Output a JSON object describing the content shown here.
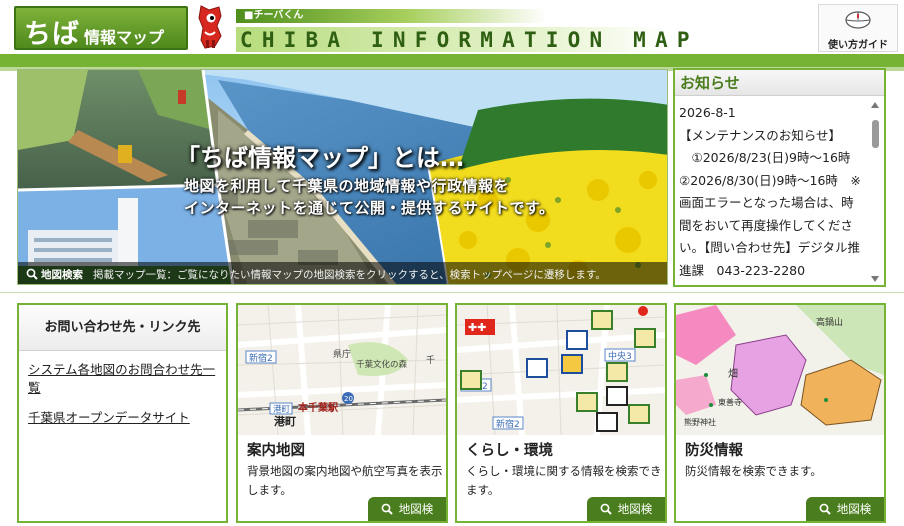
{
  "header": {
    "logo_main": "ちば",
    "logo_sub": "情報マップ",
    "mascot_label": "■チーバくん",
    "title": "CHIBA INFORMATION MAP",
    "guide_label": "使い方ガイド",
    "guide_icon": "mouse-icon"
  },
  "hero": {
    "heading": "「ちば情報マップ」とは…",
    "line1": "地図を利用して千葉県の地域情報や行政情報を",
    "line2": "インターネットを通じて公開・提供するサイトです。",
    "caption_label": "地図検索",
    "caption_text": "掲載マップ一覧：ご覧になりたい情報マップの地図検索をクリックすると、検索トップページに遷移します。"
  },
  "notice": {
    "title": "お知らせ",
    "body": "2026-8-1\n【メンテナンスのお知らせ】\n　①2026/8/23(日)9時〜16時　②2026/8/30(日)9時〜16時　※画面エラーとなった場合は、時間をおいて再度操作してください。【問い合わせ先】デジタル推進課　043-223-2280"
  },
  "contact": {
    "heading": "お問い合わせ先・リンク先",
    "links": [
      "システム各地図のお問合わせ先一覧",
      "千葉県オープンデータサイト"
    ]
  },
  "cards": [
    {
      "title": "案内地図",
      "desc": "背景地図の案内地図や航空写真を表示します。",
      "button": "地図検",
      "map_labels": [
        "新宿2",
        "県庁",
        "千葉文化の森",
        "本千葉駅",
        "港町",
        "港町",
        "20",
        "千"
      ]
    },
    {
      "title": "くらし・環境",
      "desc": "くらし・環境に関する情報を検索できます。",
      "button": "地図検",
      "map_labels": [
        "新宿2",
        "中央3",
        "新宿2"
      ]
    },
    {
      "title": "防災情報",
      "desc": "防災情報を検索できます。",
      "button": "地図検",
      "map_labels": [
        "高鍋山",
        "畑",
        "東善寺",
        "熊野神社"
      ]
    }
  ],
  "colors": {
    "brand_green": "#76b335",
    "dark_green": "#4a7d1d",
    "title_green": "#2e5f12"
  }
}
